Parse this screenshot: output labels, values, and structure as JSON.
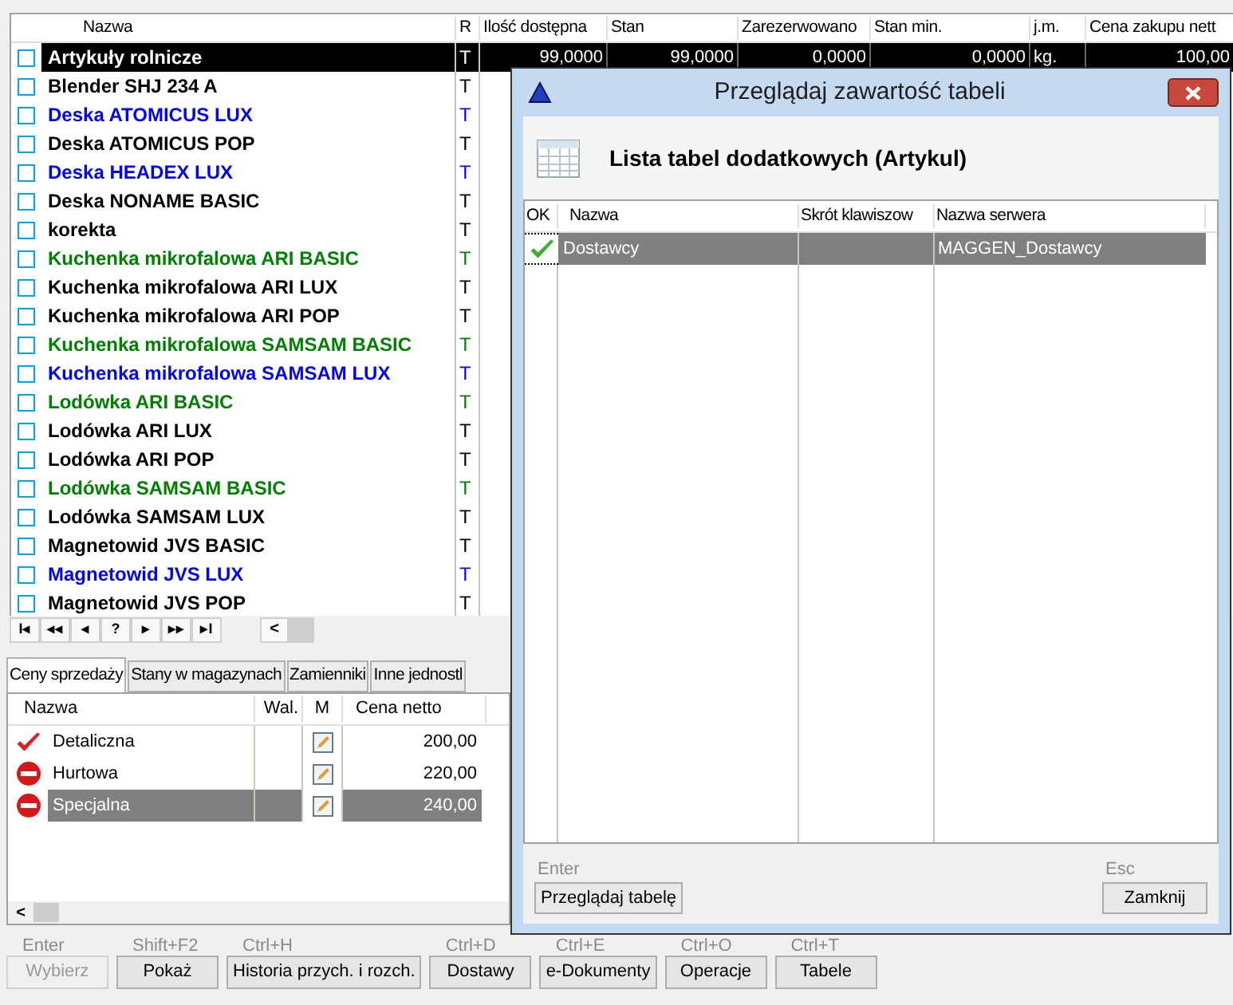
{
  "main_table": {
    "columns": [
      "Nazwa",
      "R",
      "Ilość dostępna",
      "Stan",
      "Zarezerwowano",
      "Stan min.",
      "j.m.",
      "Cena zakupu nett"
    ],
    "rows": [
      {
        "name": "Artykuły rolnicze",
        "r": "T",
        "color": "#000000",
        "selected": true,
        "checked": false,
        "cells": [
          "99,0000",
          "99,0000",
          "0,0000",
          "0,0000",
          "kg.",
          "100,00"
        ]
      },
      {
        "name": "Blender SHJ 234 A",
        "r": "T",
        "color": "#000000",
        "selected": false,
        "checked": false
      },
      {
        "name": "Deska ATOMICUS LUX",
        "r": "T",
        "color": "#0000ff",
        "selected": false,
        "checked": false
      },
      {
        "name": "Deska ATOMICUS POP",
        "r": "T",
        "color": "#000000",
        "selected": false,
        "checked": false
      },
      {
        "name": "Deska HEADEX LUX",
        "r": "T",
        "color": "#0000ff",
        "selected": false,
        "checked": false
      },
      {
        "name": "Deska NONAME BASIC",
        "r": "T",
        "color": "#000000",
        "selected": false,
        "checked": false
      },
      {
        "name": "korekta",
        "r": "T",
        "color": "#000000",
        "selected": false,
        "checked": false
      },
      {
        "name": "Kuchenka mikrofalowa ARI BASIC",
        "r": "T",
        "color": "#008000",
        "selected": false,
        "checked": false
      },
      {
        "name": "Kuchenka mikrofalowa ARI LUX",
        "r": "T",
        "color": "#000000",
        "selected": false,
        "checked": false
      },
      {
        "name": "Kuchenka mikrofalowa ARI POP",
        "r": "T",
        "color": "#000000",
        "selected": false,
        "checked": false
      },
      {
        "name": "Kuchenka mikrofalowa SAMSAM BASIC",
        "r": "T",
        "color": "#008000",
        "selected": false,
        "checked": false
      },
      {
        "name": "Kuchenka mikrofalowa SAMSAM LUX",
        "r": "T",
        "color": "#0000ff",
        "selected": false,
        "checked": false
      },
      {
        "name": "Lodówka ARI BASIC",
        "r": "T",
        "color": "#008000",
        "selected": false,
        "checked": false
      },
      {
        "name": "Lodówka ARI LUX",
        "r": "T",
        "color": "#000000",
        "selected": false,
        "checked": false
      },
      {
        "name": "Lodówka ARI POP",
        "r": "T",
        "color": "#000000",
        "selected": false,
        "checked": false
      },
      {
        "name": "Lodówka SAMSAM BASIC",
        "r": "T",
        "color": "#008000",
        "selected": false,
        "checked": false
      },
      {
        "name": "Lodówka SAMSAM LUX",
        "r": "T",
        "color": "#000000",
        "selected": false,
        "checked": false
      },
      {
        "name": "Magnetowid JVS BASIC",
        "r": "T",
        "color": "#000000",
        "selected": false,
        "checked": false
      },
      {
        "name": "Magnetowid JVS LUX",
        "r": "T",
        "color": "#0000ff",
        "selected": false,
        "checked": false
      },
      {
        "name": "Magnetowid JVS POP",
        "r": "T",
        "color": "#000000",
        "selected": false,
        "checked": false
      }
    ]
  },
  "navigator": [
    "I◂",
    "◂◂",
    "◂",
    "?",
    "▸",
    "▸▸",
    "▸I",
    "<"
  ],
  "detail_tabs": [
    {
      "label": "Ceny sprzedaży",
      "selected": true
    },
    {
      "label": "Stany w magazynach",
      "selected": false
    },
    {
      "label": "Zamienniki",
      "selected": false
    },
    {
      "label": "Inne jednostl",
      "selected": false
    }
  ],
  "price_table": {
    "columns": [
      "Nazwa",
      "Wal.",
      "M",
      "Cena netto"
    ],
    "rows": [
      {
        "kind": "check",
        "name": "Detaliczna",
        "price": "200,00",
        "selected": false
      },
      {
        "kind": "stop",
        "name": "Hurtowa",
        "price": "220,00",
        "selected": false
      },
      {
        "kind": "stop",
        "name": "Specjalna",
        "price": "240,00",
        "selected": true
      }
    ],
    "scroll": "<"
  },
  "actions": [
    {
      "shortcut": "Enter",
      "label": "Wybierz",
      "disabled": true
    },
    {
      "shortcut": "Shift+F2",
      "label": "Pokaż",
      "disabled": false
    },
    {
      "shortcut": "Ctrl+H",
      "label": "Historia przych. i rozch.",
      "disabled": false
    },
    {
      "shortcut": "Ctrl+D",
      "label": "Dostawy",
      "disabled": false
    },
    {
      "shortcut": "Ctrl+E",
      "label": "e-Dokumenty",
      "disabled": false
    },
    {
      "shortcut": "Ctrl+O",
      "label": "Operacje",
      "disabled": false
    },
    {
      "shortcut": "Ctrl+T",
      "label": "Tabele",
      "disabled": false
    }
  ],
  "dialog": {
    "title": "Przeglądaj zawartość tabeli",
    "heading": "Lista tabel dodatkowych (Artykul)",
    "columns": [
      "OK",
      "Nazwa",
      "Skrót klawiszow",
      "Nazwa serwera"
    ],
    "rows": [
      {
        "ok": true,
        "name": "Dostawcy",
        "server": "MAGGEN_Dostawcy",
        "selected": true
      }
    ],
    "left_button": {
      "shortcut": "Enter",
      "label": "Przeglądaj tabelę"
    },
    "right_button": {
      "shortcut": "Esc",
      "label": "Zamknij"
    }
  }
}
